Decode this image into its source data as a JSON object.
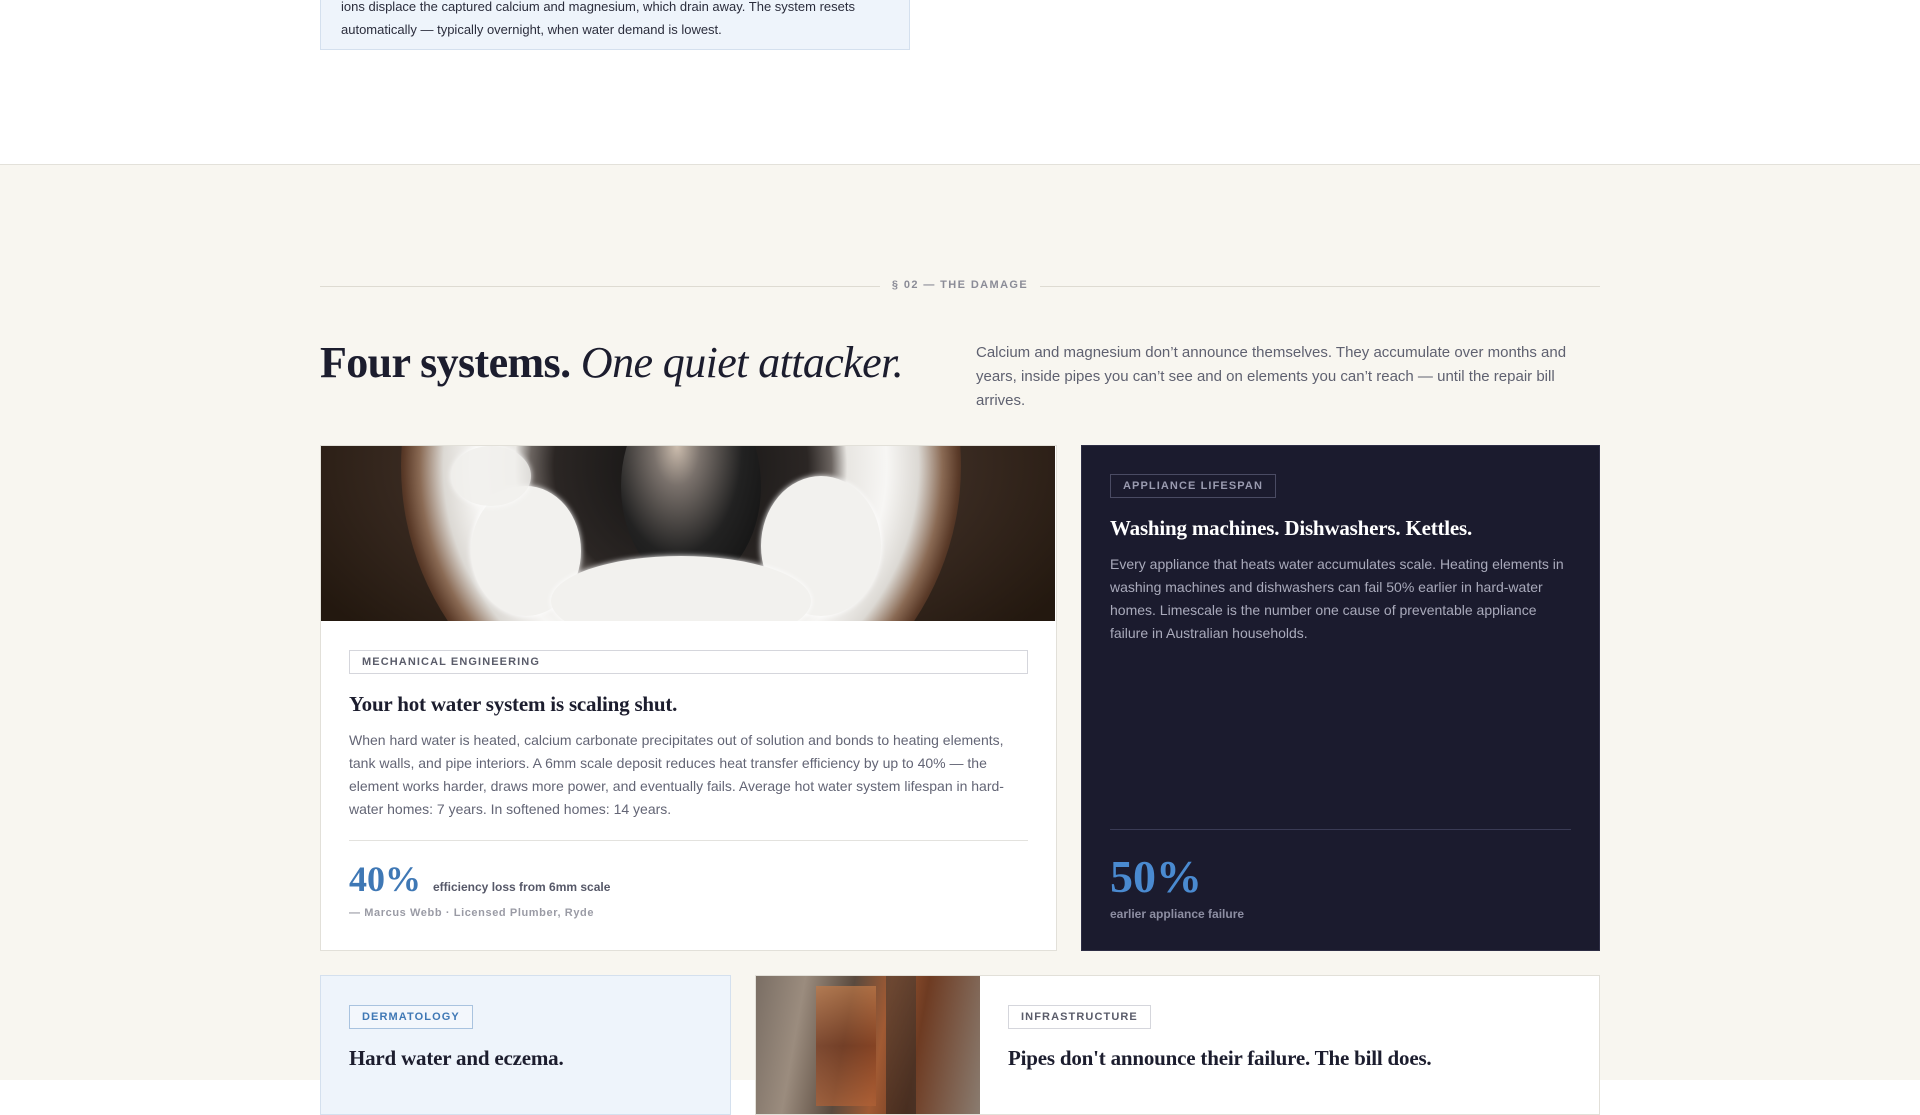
{
  "previous_callout": {
    "line1": "ions displace the captured calcium and magnesium, which drain away. The system resets",
    "line2": "automatically — typically overnight, when water demand is lowest."
  },
  "section": {
    "eyebrow": "§ 02 — THE DAMAGE",
    "headline_bold": "Four systems.",
    "headline_italic": "One quiet attacker.",
    "intro": "Calcium and magnesium don’t announce themselves. They accumulate over months and years, inside pipes you can’t see and on elements you can’t reach — until the repair bill arrives."
  },
  "cards": {
    "hot_water": {
      "tag": "MECHANICAL ENGINEERING",
      "title": "Your hot water system is scaling shut.",
      "body": "When hard water is heated, calcium carbonate precipitates out of solution and bonds to heating elements, tank walls, and pipe interiors. A 6mm scale deposit reduces heat transfer efficiency by up to 40% — the element works harder, draws more power, and eventually fails. Average hot water system lifespan in hard-water homes: 7 years. In softened homes: 14 years.",
      "stat_value": "40%",
      "stat_label": "efficiency loss from 6mm scale",
      "attribution": "— Marcus Webb · Licensed Plumber, Ryde"
    },
    "appliances": {
      "tag": "APPLIANCE LIFESPAN",
      "title": "Washing machines. Dishwashers. Kettles.",
      "body": "Every appliance that heats water accumulates scale. Heating elements in washing machines and dishwashers can fail 50% earlier in hard-water homes. Limescale is the number one cause of preventable appliance failure in Australian households.",
      "stat_value": "50%",
      "stat_label": "earlier appliance failure"
    },
    "dermatology": {
      "tag": "DERMATOLOGY",
      "title": "Hard water and eczema."
    },
    "infrastructure": {
      "tag": "INFRASTRUCTURE",
      "title": "Pipes don't announce their failure. The bill does."
    }
  },
  "colors": {
    "accent_blue": "#3f78b5",
    "dark_card": "#1b1b2e",
    "section_bg": "#f8f6f0",
    "callout_bg": "#eef4fb"
  }
}
